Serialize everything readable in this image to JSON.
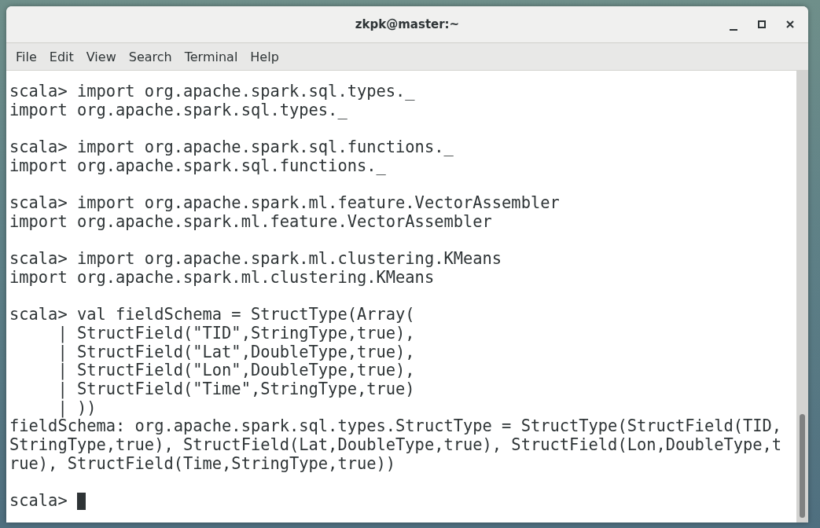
{
  "window": {
    "title": "zkpk@master:~",
    "controls": [
      {
        "kind": "minimize"
      },
      {
        "kind": "maximize"
      },
      {
        "kind": "close"
      }
    ]
  },
  "menu": [
    "File",
    "Edit",
    "View",
    "Search",
    "Terminal",
    "Help"
  ],
  "terminal": {
    "cursor": true,
    "blocks": [
      {
        "lines": [
          "scala> import org.apache.spark.sql.types._",
          "import org.apache.spark.sql.types._"
        ]
      },
      {
        "lines": [
          "scala> import org.apache.spark.sql.functions._",
          "import org.apache.spark.sql.functions._"
        ]
      },
      {
        "lines": [
          "scala> import org.apache.spark.ml.feature.VectorAssembler",
          "import org.apache.spark.ml.feature.VectorAssembler"
        ]
      },
      {
        "lines": [
          "scala> import org.apache.spark.ml.clustering.KMeans",
          "import org.apache.spark.ml.clustering.KMeans"
        ]
      },
      {
        "lines": [
          "scala> val fieldSchema = StructType(Array(",
          "     | StructField(\"TID\",StringType,true),",
          "     | StructField(\"Lat\",DoubleType,true),",
          "     | StructField(\"Lon\",DoubleType,true),",
          "     | StructField(\"Time\",StringType,true)",
          "     | ))",
          "fieldSchema: org.apache.spark.sql.types.StructType = StructType(StructField(TID,",
          "StringType,true), StructField(Lat,DoubleType,true), StructField(Lon,DoubleType,t",
          "rue), StructField(Time,StringType,true))"
        ]
      },
      {
        "lines": [
          "scala> "
        ]
      }
    ]
  }
}
